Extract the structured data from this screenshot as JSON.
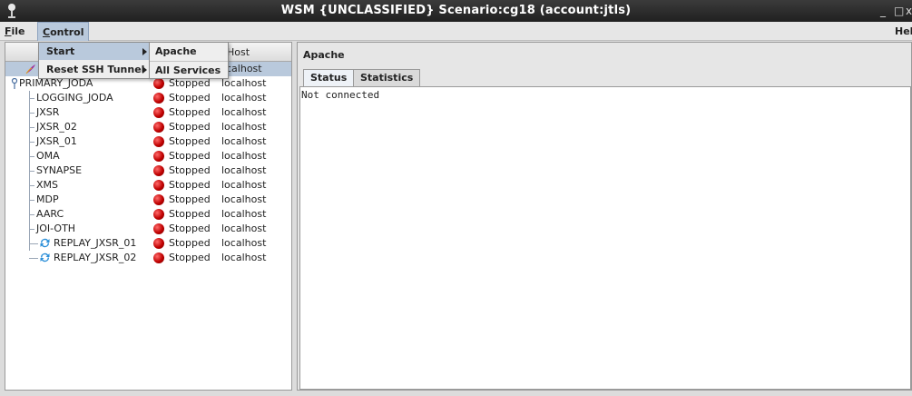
{
  "window": {
    "title": "WSM {UNCLASSIFIED}  Scenario:cg18     (account:jtls)",
    "minimize_glyph": "_",
    "maximize_glyph": "□",
    "close_glyph": "x"
  },
  "menubar": {
    "file_mnemonic": "F",
    "file_rest": "ile",
    "control_mnemonic": "C",
    "control_rest": "ontrol",
    "help_label": "Hel"
  },
  "control_menu": {
    "items": [
      {
        "label": "Start",
        "has_submenu": true
      },
      {
        "label": "Reset SSH Tunnel",
        "has_submenu": true
      }
    ],
    "submenu": [
      "Apache",
      "All Services"
    ]
  },
  "tree_table": {
    "host_header": "Host",
    "root": {
      "label": "PRIMARY_JODA",
      "status": "Stopped",
      "host": "localhost"
    },
    "apache_host_fragment": "calhost",
    "children": [
      {
        "label": "LOGGING_JODA",
        "status": "Stopped",
        "host": "localhost",
        "icon": "none"
      },
      {
        "label": "JXSR",
        "status": "Stopped",
        "host": "localhost",
        "icon": "none"
      },
      {
        "label": "JXSR_02",
        "status": "Stopped",
        "host": "localhost",
        "icon": "none"
      },
      {
        "label": "JXSR_01",
        "status": "Stopped",
        "host": "localhost",
        "icon": "none"
      },
      {
        "label": "OMA",
        "status": "Stopped",
        "host": "localhost",
        "icon": "none"
      },
      {
        "label": "SYNAPSE",
        "status": "Stopped",
        "host": "localhost",
        "icon": "none"
      },
      {
        "label": "XMS",
        "status": "Stopped",
        "host": "localhost",
        "icon": "none"
      },
      {
        "label": "MDP",
        "status": "Stopped",
        "host": "localhost",
        "icon": "none"
      },
      {
        "label": "AARC",
        "status": "Stopped",
        "host": "localhost",
        "icon": "none"
      },
      {
        "label": "JOI-OTH",
        "status": "Stopped",
        "host": "localhost",
        "icon": "none"
      },
      {
        "label": "REPLAY_JXSR_01",
        "status": "Stopped",
        "host": "localhost",
        "icon": "refresh-icon"
      },
      {
        "label": "REPLAY_JXSR_02",
        "status": "Stopped",
        "host": "localhost",
        "icon": "refresh-icon"
      }
    ]
  },
  "detail_panel": {
    "title": "Apache",
    "tabs": [
      "Status",
      "Statistics"
    ],
    "active_tab": "Status",
    "message": "Not connected"
  },
  "colors": {
    "selection": "#b9c9dc",
    "status_stopped": "#c00000",
    "titlebar": "#2a2a2a"
  }
}
